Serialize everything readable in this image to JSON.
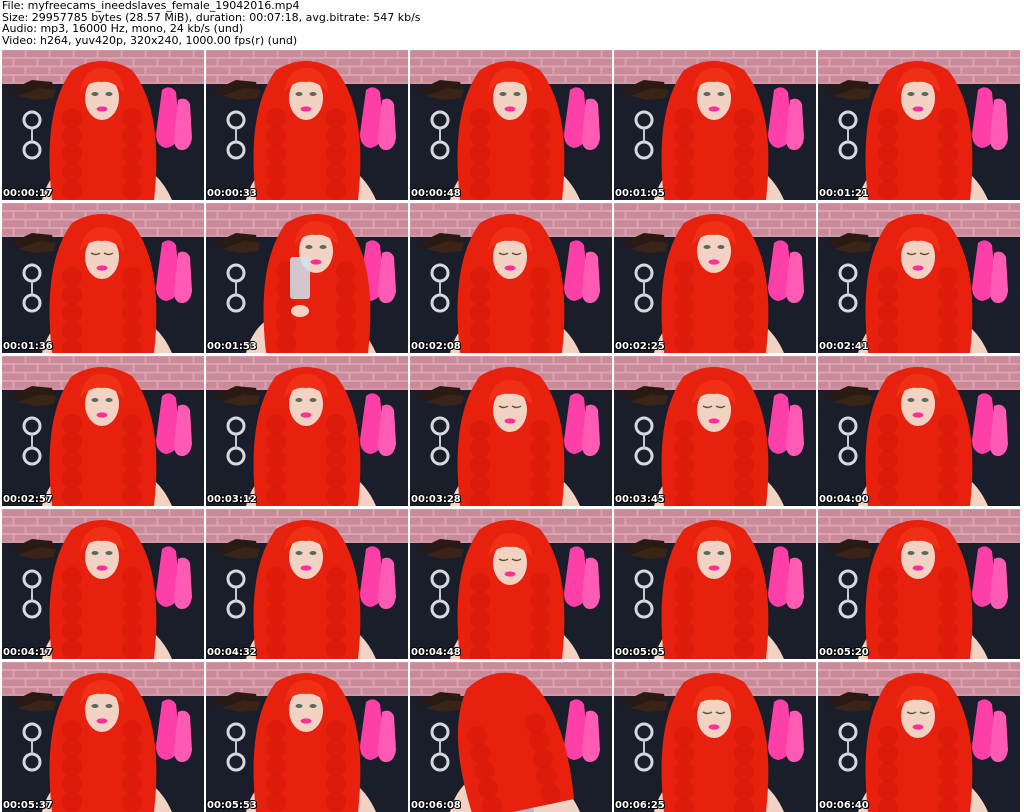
{
  "header": {
    "file": "File: myfreecams_ineedslaves_female_19042016.mp4",
    "size": "Size: 29957785 bytes (28.57 MiB), duration: 00:07:18, avg.bitrate: 547 kb/s",
    "audio": "Audio: mp3, 16000 Hz, mono, 24 kb/s (und)",
    "video": "Video: h264, yuv420p, 320x240, 1000.00 fps(r) (und)"
  },
  "thumbnails": [
    {
      "timestamp": "00:00:17",
      "pose": "front"
    },
    {
      "timestamp": "00:00:33",
      "pose": "front"
    },
    {
      "timestamp": "00:00:48",
      "pose": "front"
    },
    {
      "timestamp": "00:01:05",
      "pose": "front"
    },
    {
      "timestamp": "00:01:21",
      "pose": "front"
    },
    {
      "timestamp": "00:01:36",
      "pose": "down"
    },
    {
      "timestamp": "00:01:53",
      "pose": "drink"
    },
    {
      "timestamp": "00:02:08",
      "pose": "down"
    },
    {
      "timestamp": "00:02:25",
      "pose": "front"
    },
    {
      "timestamp": "00:02:41",
      "pose": "down"
    },
    {
      "timestamp": "00:02:57",
      "pose": "front"
    },
    {
      "timestamp": "00:03:12",
      "pose": "front"
    },
    {
      "timestamp": "00:03:28",
      "pose": "down"
    },
    {
      "timestamp": "00:03:45",
      "pose": "down"
    },
    {
      "timestamp": "00:04:00",
      "pose": "front"
    },
    {
      "timestamp": "00:04:17",
      "pose": "front"
    },
    {
      "timestamp": "00:04:32",
      "pose": "front"
    },
    {
      "timestamp": "00:04:48",
      "pose": "down"
    },
    {
      "timestamp": "00:05:05",
      "pose": "front"
    },
    {
      "timestamp": "00:05:20",
      "pose": "front"
    },
    {
      "timestamp": "00:05:37",
      "pose": "front"
    },
    {
      "timestamp": "00:05:53",
      "pose": "front"
    },
    {
      "timestamp": "00:06:08",
      "pose": "turned"
    },
    {
      "timestamp": "00:06:25",
      "pose": "down"
    },
    {
      "timestamp": "00:06:40",
      "pose": "down"
    }
  ],
  "colors": {
    "hair": "#e8200e",
    "wall": "#c98a9a",
    "backdrop": "#1a1d2a",
    "gloves": "#ff3fa8",
    "skin": "#f2d2c2",
    "top": "#b0b4c4"
  }
}
